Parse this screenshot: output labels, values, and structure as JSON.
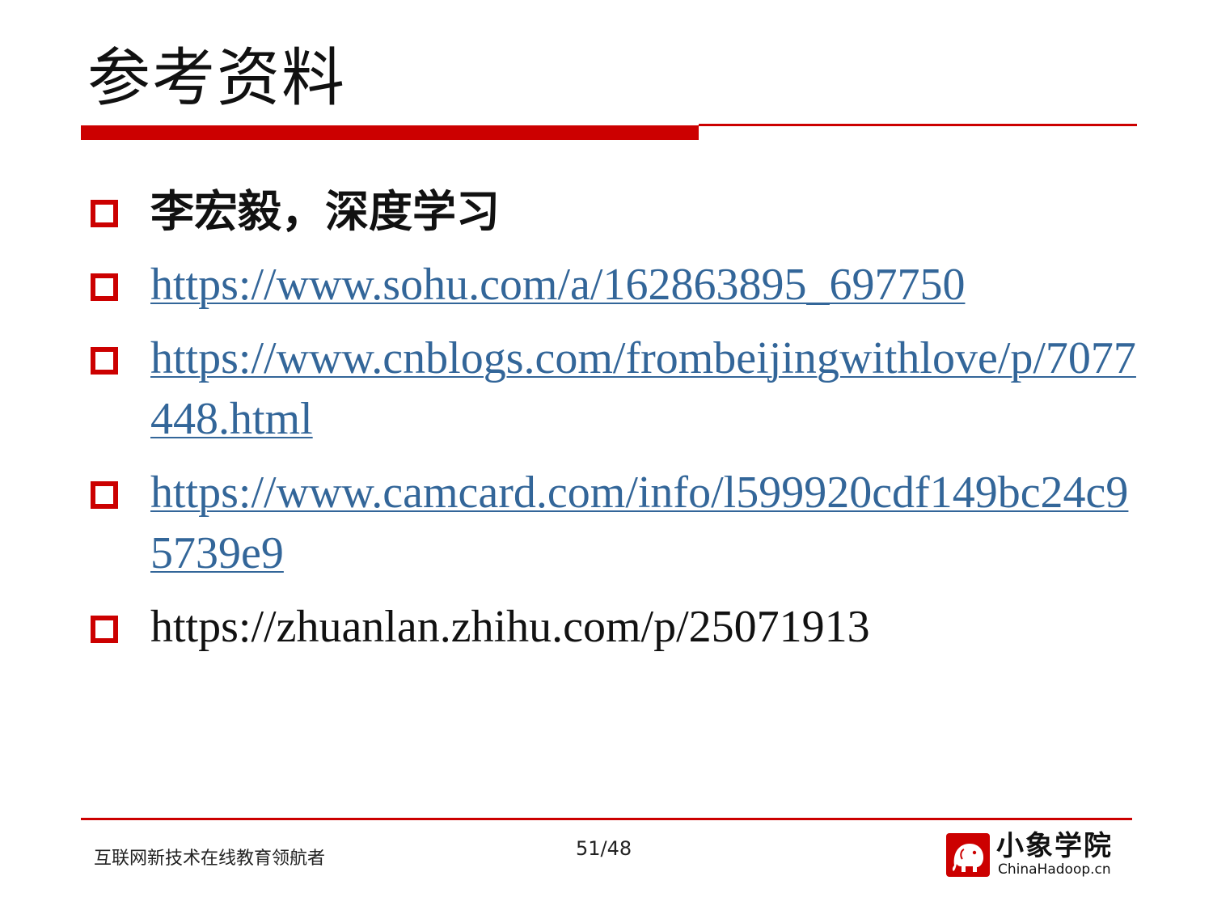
{
  "slide": {
    "title": "参考资料",
    "references": [
      {
        "text": "李宏毅，深度学习",
        "style": "bold"
      },
      {
        "text": "https://www.sohu.com/a/162863895_697750",
        "style": "link"
      },
      {
        "text": "https://www.cnblogs.com/frombeijingwithlove/p/7077448.html",
        "style": "link"
      },
      {
        "text": "https://www.camcard.com/info/l599920cdf149bc24c95739e9",
        "style": "link"
      },
      {
        "text": "https://zhuanlan.zhihu.com/p/25071913",
        "style": "plain"
      }
    ]
  },
  "footer": {
    "slogan": "互联网新技术在线教育领航者",
    "page_number": "51/48",
    "logo_name": "小象学院",
    "logo_domain": "ChinaHadoop.cn",
    "logo_icon": "elephant-icon"
  },
  "colors": {
    "accent": "#cc0000",
    "link": "#336699",
    "text": "#111111"
  }
}
